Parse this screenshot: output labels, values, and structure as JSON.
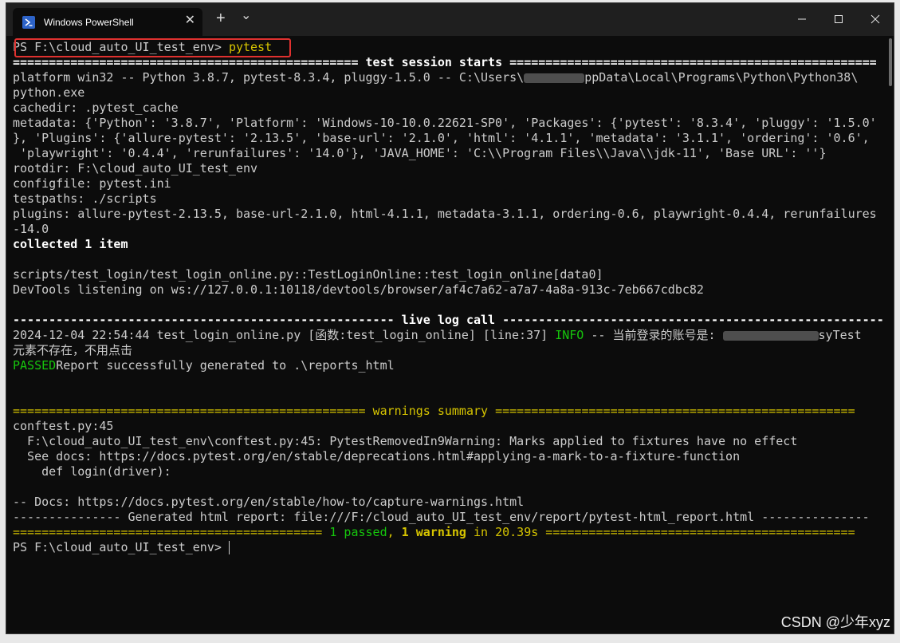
{
  "window": {
    "tab_title": "Windows PowerShell",
    "new_tab": "+",
    "dropdown": "⌄",
    "close_tab": "✕",
    "minimize": "—",
    "maximize": "☐",
    "close": "✕"
  },
  "terminal": {
    "prompt_line": "PS F:\\cloud_auto_UI_test_env> ",
    "command": "pytest",
    "session_rule_left": "================================================ ",
    "session_title": "test session starts",
    "session_rule_right": " ===================================================",
    "platform_a": "platform win32 -- Python 3.8.7, pytest-8.3.4, pluggy-1.5.0 -- C:\\Users\\",
    "platform_b": "ppData\\Local\\Programs\\Python\\Python38\\",
    "platform_c": "python.exe",
    "cachedir": "cachedir: .pytest_cache",
    "metadata_1": "metadata: {'Python': '3.8.7', 'Platform': 'Windows-10-10.0.22621-SP0', 'Packages': {'pytest': '8.3.4', 'pluggy': '1.5.0'",
    "metadata_2": "}, 'Plugins': {'allure-pytest': '2.13.5', 'base-url': '2.1.0', 'html': '4.1.1', 'metadata': '3.1.1', 'ordering': '0.6',",
    "metadata_3": " 'playwright': '0.4.4', 'rerunfailures': '14.0'}, 'JAVA_HOME': 'C:\\\\Program Files\\\\Java\\\\jdk-11', 'Base URL': ''}",
    "rootdir": "rootdir: F:\\cloud_auto_UI_test_env",
    "configfile": "configfile: pytest.ini",
    "testpaths": "testpaths: ./scripts",
    "plugins_1": "plugins: allure-pytest-2.13.5, base-url-2.1.0, html-4.1.1, metadata-3.1.1, ordering-0.6, playwright-0.4.4, rerunfailures",
    "plugins_2": "-14.0",
    "collected": "collected 1 item",
    "test_id": "scripts/test_login/test_login_online.py::TestLoginOnline::test_login_online[data0]",
    "devtools": "DevTools listening on ws://127.0.0.1:10118/devtools/browser/af4c7a62-a7a7-4a8a-913c-7eb667cdbc82",
    "live_rule_left": "----------------------------------------------------- ",
    "live_title": "live log call",
    "live_rule_right": " -----------------------------------------------------",
    "log_prefix": "2024-12-04 22:54:44 test_login_online.py [函数:test_login_online] [line:37] ",
    "log_level": "INFO",
    "log_msg": " -- 当前登录的账号是: ",
    "log_user_tail": "syTest",
    "log_element": "元素不存在，不用点击",
    "passed": "PASSED",
    "report_msg": "Report successfully generated to .\\reports_html",
    "warn_rule_left": "================================================= ",
    "warn_title": "warnings summary",
    "warn_rule_right": " ==================================================",
    "conftest": "conftest.py:45",
    "warn_1": "  F:\\cloud_auto_UI_test_env\\conftest.py:45: PytestRemovedIn9Warning: Marks applied to fixtures have no effect",
    "warn_2": "  See docs: https://docs.pytest.org/en/stable/deprecations.html#applying-a-mark-to-a-fixture-function",
    "warn_3": "    def login(driver):",
    "docs": "-- Docs: https://docs.pytest.org/en/stable/how-to/capture-warnings.html",
    "generated": "--------------- Generated html report: file:///F:/cloud_auto_UI_test_env/report/pytest-html_report.html ---------------",
    "sum_rule_left": "=========================================== ",
    "sum_passed": "1 passed",
    "sum_comma": ", ",
    "sum_warning": "1 warning",
    "sum_time": " in 20.39s",
    "sum_rule_right": " ===========================================",
    "final_prompt": "PS F:\\cloud_auto_UI_test_env> "
  },
  "watermark": "CSDN @少年xyz"
}
